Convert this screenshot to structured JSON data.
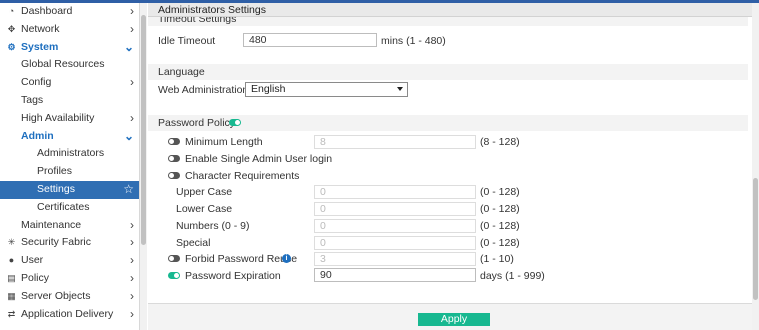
{
  "sidebar": {
    "items": [
      {
        "label": "Dashboard",
        "icon": "dashboard-icon",
        "glyph": "◔",
        "chevron": "›"
      },
      {
        "label": "Network",
        "icon": "network-icon",
        "glyph": "✥",
        "chevron": "›"
      },
      {
        "label": "System",
        "icon": "gear-icon",
        "glyph": "⚙",
        "chevron": "⌄"
      },
      {
        "label": "Global Resources"
      },
      {
        "label": "Config",
        "chevron": "›"
      },
      {
        "label": "Tags"
      },
      {
        "label": "High Availability",
        "chevron": "›"
      },
      {
        "label": "Admin",
        "chevron": "⌄"
      },
      {
        "label": "Administrators"
      },
      {
        "label": "Profiles"
      },
      {
        "label": "Settings",
        "star": "☆"
      },
      {
        "label": "Certificates"
      },
      {
        "label": "Maintenance",
        "chevron": "›"
      },
      {
        "label": "Security Fabric",
        "icon": "security-fabric-icon",
        "glyph": "✳",
        "chevron": "›"
      },
      {
        "label": "User",
        "icon": "user-icon",
        "glyph": "●",
        "chevron": "›"
      },
      {
        "label": "Policy",
        "icon": "policy-icon",
        "glyph": "▤",
        "chevron": "›"
      },
      {
        "label": "Server Objects",
        "icon": "server-objects-icon",
        "glyph": "▦",
        "chevron": "›"
      },
      {
        "label": "Application Delivery",
        "icon": "application-delivery-icon",
        "glyph": "⇄",
        "chevron": "›"
      }
    ]
  },
  "header": {
    "title": "Administrators Settings"
  },
  "timeout": {
    "section_title": "Timeout Settings",
    "idle_label": "Idle Timeout",
    "idle_value": "480",
    "idle_unit": "mins (1 - 480)"
  },
  "language": {
    "section_title": "Language",
    "web_admin_label": "Web Administration",
    "web_admin_value": "English"
  },
  "password": {
    "section_title": "Password Policy",
    "policy_enabled": true,
    "min_length": {
      "label": "Minimum Length",
      "value": "8",
      "range": "(8 - 128)",
      "enabled": false
    },
    "single_admin": {
      "label": "Enable Single Admin User login",
      "enabled": false
    },
    "char_req": {
      "label": "Character Requirements",
      "enabled": false
    },
    "upper": {
      "label": "Upper Case",
      "value": "0",
      "range": "(0 - 128)"
    },
    "lower": {
      "label": "Lower Case",
      "value": "0",
      "range": "(0 - 128)"
    },
    "numbers": {
      "label": "Numbers (0 - 9)",
      "value": "0",
      "range": "(0 - 128)"
    },
    "special": {
      "label": "Special",
      "value": "0",
      "range": "(0 - 128)"
    },
    "forbid_reuse": {
      "label": "Forbid Password Reuse",
      "value": "3",
      "range": "(1 - 10)",
      "enabled": false,
      "info_glyph": "i"
    },
    "expiration": {
      "label": "Password Expiration",
      "value": "90",
      "range": "days (1 - 999)",
      "enabled": true
    }
  },
  "footer": {
    "apply_label": "Apply"
  },
  "colors": {
    "accent": "#17b890",
    "nav_active": "#2f6eb3",
    "nav_open": "#1e6fbf"
  }
}
